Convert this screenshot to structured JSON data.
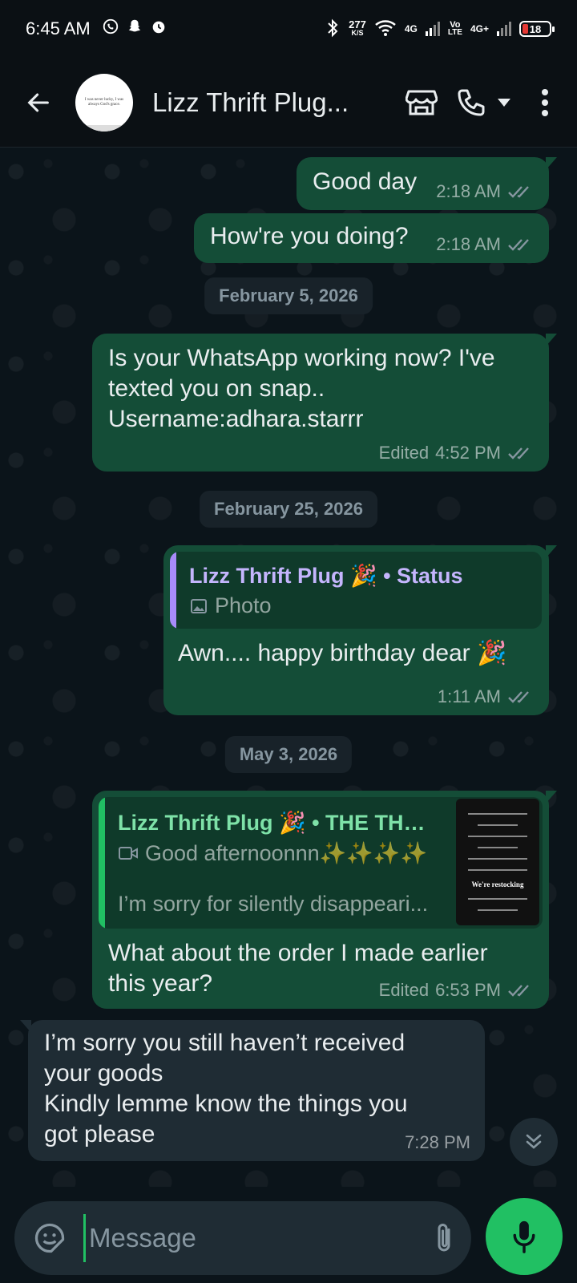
{
  "status_bar": {
    "time": "6:45 AM",
    "speed_value": "277",
    "speed_unit": "K/S",
    "network_1": "4G",
    "volte_top": "Vo",
    "volte_bottom": "LTE",
    "network_2": "4G+",
    "battery": "18"
  },
  "header": {
    "contact_name": "Lizz Thrift Plug...",
    "avatar_text": "I was never lucky, I was always God's grace."
  },
  "messages": {
    "m1": {
      "text": "Good day",
      "time": "2:18 AM"
    },
    "m2": {
      "text": "How're you doing?",
      "time": "2:18 AM"
    },
    "date1": "February 5, 2026",
    "m3": {
      "line1": "Is your WhatsApp working now? I've",
      "line2": "texted you on snap..",
      "line3": "Username:adhara.starrr",
      "edited": "Edited",
      "time": "4:52 PM"
    },
    "date2": "February 25, 2026",
    "m4": {
      "quote_title": "Lizz Thrift Plug 🎉 • Status",
      "quote_sub": "Photo",
      "text": "Awn.... happy birthday dear 🎉",
      "time": "1:11 AM"
    },
    "date3": "May 3, 2026",
    "m5": {
      "quote_title": "Lizz Thrift Plug 🎉 • THE THRI...",
      "quote_sub": "Good afternoonnn✨✨✨✨",
      "quote_extra": "I’m sorry for silently disappeari...",
      "thumb_title": "We're restocking",
      "line1": "What about the order I made earlier",
      "line2": "this year?",
      "edited": "Edited",
      "time": "6:53 PM"
    },
    "m6": {
      "line1": "I’m sorry you still haven’t received",
      "line2": "your goods",
      "line3": "Kindly lemme know the things you",
      "line4": "got please",
      "time": "7:28 PM"
    }
  },
  "input": {
    "placeholder": "Message"
  },
  "colors": {
    "accent": "#21c063",
    "bubble_out": "#144d37",
    "bubble_in": "#1f2c34",
    "status_quote_bar": "#a78bfa",
    "channel_quote_bar": "#21c063",
    "status_title": "#c4b5fd",
    "channel_title": "#7ee2a8"
  },
  "icons": {
    "back": "arrow-left-icon",
    "store": "store-icon",
    "call": "phone-icon",
    "more": "more-vertical-icon",
    "sticker": "sticker-icon",
    "attach": "paperclip-icon",
    "camera": "camera-icon",
    "mic": "mic-icon",
    "read": "double-check-icon"
  }
}
